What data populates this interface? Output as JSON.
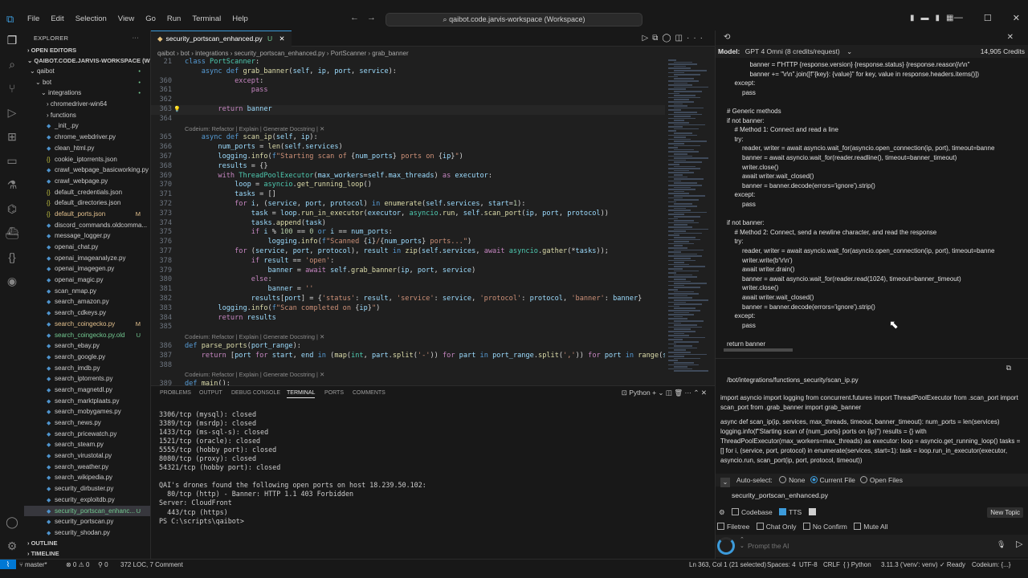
{
  "titlebar": {
    "menu": [
      "File",
      "Edit",
      "Selection",
      "View",
      "Go",
      "Run",
      "Terminal",
      "Help"
    ],
    "search_text": "qaibot.code.jarvis-workspace (Workspace)"
  },
  "sidebar": {
    "title": "EXPLORER",
    "open_editors": "OPEN EDITORS",
    "workspace": "QAIBOT.CODE.JARVIS-WORKSPACE (WOR...",
    "tree": [
      {
        "label": "qaibot",
        "kind": "folder-open",
        "indent": 1,
        "badge": "•"
      },
      {
        "label": "bot",
        "kind": "folder-open",
        "indent": 2,
        "badge": "•"
      },
      {
        "label": "integrations",
        "kind": "folder-open",
        "indent": 3,
        "badge": "•"
      },
      {
        "label": "chromedriver-win64",
        "kind": "folder",
        "indent": 4,
        "badge": ""
      },
      {
        "label": "functions",
        "kind": "folder",
        "indent": 4,
        "badge": ""
      },
      {
        "label": "_init_.py",
        "kind": "py",
        "indent": 4,
        "badge": ""
      },
      {
        "label": "chrome_webdriver.py",
        "kind": "py",
        "indent": 4,
        "badge": ""
      },
      {
        "label": "clean_html.py",
        "kind": "py",
        "indent": 4,
        "badge": ""
      },
      {
        "label": "cookie_iptorrents.json",
        "kind": "json",
        "indent": 4,
        "badge": ""
      },
      {
        "label": "crawl_webpage_basicworking.py",
        "kind": "py",
        "indent": 4,
        "badge": ""
      },
      {
        "label": "crawl_webpage.py",
        "kind": "py",
        "indent": 4,
        "badge": ""
      },
      {
        "label": "default_credentials.json",
        "kind": "json",
        "indent": 4,
        "badge": ""
      },
      {
        "label": "default_directories.json",
        "kind": "json",
        "indent": 4,
        "badge": ""
      },
      {
        "label": "default_ports.json",
        "kind": "json",
        "indent": 4,
        "badge": "M"
      },
      {
        "label": "discord_commands.oldcomma...",
        "kind": "py",
        "indent": 4,
        "badge": ""
      },
      {
        "label": "message_logger.py",
        "kind": "py",
        "indent": 4,
        "badge": ""
      },
      {
        "label": "openai_chat.py",
        "kind": "py",
        "indent": 4,
        "badge": ""
      },
      {
        "label": "openai_imageanalyze.py",
        "kind": "py",
        "indent": 4,
        "badge": ""
      },
      {
        "label": "openai_imagegen.py",
        "kind": "py",
        "indent": 4,
        "badge": ""
      },
      {
        "label": "openai_magic.py",
        "kind": "py",
        "indent": 4,
        "badge": ""
      },
      {
        "label": "scan_nmap.py",
        "kind": "py",
        "indent": 4,
        "badge": ""
      },
      {
        "label": "search_amazon.py",
        "kind": "py",
        "indent": 4,
        "badge": ""
      },
      {
        "label": "search_cdkeys.py",
        "kind": "py",
        "indent": 4,
        "badge": ""
      },
      {
        "label": "search_coingecko.py",
        "kind": "py",
        "indent": 4,
        "badge": "M"
      },
      {
        "label": "search_coingecko.py.old",
        "kind": "py",
        "indent": 4,
        "badge": "U"
      },
      {
        "label": "search_ebay.py",
        "kind": "py",
        "indent": 4,
        "badge": ""
      },
      {
        "label": "search_google.py",
        "kind": "py",
        "indent": 4,
        "badge": ""
      },
      {
        "label": "search_imdb.py",
        "kind": "py",
        "indent": 4,
        "badge": ""
      },
      {
        "label": "search_iptorrents.py",
        "kind": "py",
        "indent": 4,
        "badge": ""
      },
      {
        "label": "search_magnetdl.py",
        "kind": "py",
        "indent": 4,
        "badge": ""
      },
      {
        "label": "search_marktplaats.py",
        "kind": "py",
        "indent": 4,
        "badge": ""
      },
      {
        "label": "search_mobygames.py",
        "kind": "py",
        "indent": 4,
        "badge": ""
      },
      {
        "label": "search_news.py",
        "kind": "py",
        "indent": 4,
        "badge": ""
      },
      {
        "label": "search_pricewatch.py",
        "kind": "py",
        "indent": 4,
        "badge": ""
      },
      {
        "label": "search_steam.py",
        "kind": "py",
        "indent": 4,
        "badge": ""
      },
      {
        "label": "search_virustotal.py",
        "kind": "py",
        "indent": 4,
        "badge": ""
      },
      {
        "label": "search_weather.py",
        "kind": "py",
        "indent": 4,
        "badge": ""
      },
      {
        "label": "search_wikipedia.py",
        "kind": "py",
        "indent": 4,
        "badge": ""
      },
      {
        "label": "security_dirbuster.py",
        "kind": "py",
        "indent": 4,
        "badge": ""
      },
      {
        "label": "security_exploitdb.py",
        "kind": "py",
        "indent": 4,
        "badge": ""
      },
      {
        "label": "security_portscan_enhanc...",
        "kind": "py",
        "indent": 4,
        "badge": "U",
        "selected": true
      },
      {
        "label": "security_portscan.py",
        "kind": "py",
        "indent": 4,
        "badge": ""
      },
      {
        "label": "security_shodan.py",
        "kind": "py",
        "indent": 4,
        "badge": ""
      }
    ],
    "outline": "OUTLINE",
    "timeline": "TIMELINE"
  },
  "editor": {
    "tab_label": "security_portscan_enhanced.py",
    "tab_badge": "U",
    "breadcrumb": [
      "qaibot",
      "bot",
      "integrations",
      "security_portscan_enhanced.py",
      "PortScanner",
      "grab_banner"
    ],
    "lens_text": "Codeium: Refactor | Explain | Generate Docstring | ✕"
  },
  "panel": {
    "tabs": [
      "PROBLEMS",
      "OUTPUT",
      "DEBUG CONSOLE",
      "TERMINAL",
      "PORTS",
      "COMMENTS"
    ],
    "active_tab": "TERMINAL",
    "shell": "Python",
    "terminal_lines": [
      "3306/tcp (mysql): closed",
      "3389/tcp (msrdp): closed",
      "1433/tcp (ms-sql-s): closed",
      "1521/tcp (oracle): closed",
      "5555/tcp (hobby port): closed",
      "8080/tcp (proxy): closed",
      "54321/tcp (hobby port): closed",
      "",
      "QAI's drones found the following open ports on host 18.239.50.102:",
      "  80/tcp (http) - Banner: HTTP 1.1 403 Forbidden",
      "Server: CloudFront",
      "  443/tcp (https)",
      "PS C:\\scripts\\qaibot> "
    ]
  },
  "chat": {
    "model_label": "Model:",
    "model_value": "GPT 4 Omni (8 credits/request)",
    "credits": "14,905 Credits",
    "response_lines": [
      {
        "t": "banner = f\"HTTP {response.version} {response.status} {response.reason}\\r\\n\"",
        "i": 3
      },
      {
        "t": "banner += \"\\r\\n\".join([f\"{key}: {value}\" for key, value in response.headers.items()])",
        "i": 3
      },
      {
        "t": "except:",
        "i": 1
      },
      {
        "t": "pass",
        "i": 2
      },
      {
        "t": "",
        "i": 0
      },
      {
        "t": "# Generic methods",
        "i": 0
      },
      {
        "t": "if not banner:",
        "i": 0
      },
      {
        "t": "# Method 1: Connect and read a line",
        "i": 1
      },
      {
        "t": "try:",
        "i": 1
      },
      {
        "t": "reader, writer = await asyncio.wait_for(asyncio.open_connection(ip, port), timeout=banne",
        "i": 2
      },
      {
        "t": "banner = await asyncio.wait_for(reader.readline(), timeout=banner_timeout)",
        "i": 2
      },
      {
        "t": "writer.close()",
        "i": 2
      },
      {
        "t": "await writer.wait_closed()",
        "i": 2
      },
      {
        "t": "banner = banner.decode(errors='ignore').strip()",
        "i": 2
      },
      {
        "t": "except:",
        "i": 1
      },
      {
        "t": "pass",
        "i": 2
      },
      {
        "t": "",
        "i": 0
      },
      {
        "t": "if not banner:",
        "i": 0
      },
      {
        "t": "# Method 2: Connect, send a newline character, and read the response",
        "i": 1
      },
      {
        "t": "try:",
        "i": 1
      },
      {
        "t": "reader, writer = await asyncio.wait_for(asyncio.open_connection(ip, port), timeout=banne",
        "i": 2
      },
      {
        "t": "writer.write(b'\\r\\n')",
        "i": 2
      },
      {
        "t": "await writer.drain()",
        "i": 2
      },
      {
        "t": "banner = await asyncio.wait_for(reader.read(1024), timeout=banner_timeout)",
        "i": 2
      },
      {
        "t": "writer.close()",
        "i": 2
      },
      {
        "t": "await writer.wait_closed()",
        "i": 2
      },
      {
        "t": "banner = banner.decode(errors='ignore').strip()",
        "i": 2
      },
      {
        "t": "except:",
        "i": 1
      },
      {
        "t": "pass",
        "i": 2
      },
      {
        "t": "",
        "i": 0
      },
      {
        "t": "return banner",
        "i": 0
      }
    ],
    "file_path": "/bot/integrations/functions_security/scan_ip.py",
    "summary_1": "import asyncio import logging from concurrent.futures import ThreadPoolExecutor from .scan_port import scan_port from .grab_banner import grab_banner",
    "summary_2": "async def scan_ip(ip, services, max_threads, timeout, banner_timeout): num_ports = len(services) logging.info(f\"Starting scan of {num_ports} ports on {ip}\") results = {} with ThreadPoolExecutor(max_workers=max_threads) as executor: loop = asyncio.get_running_loop() tasks = [] for i, (service, port, protocol) in enumerate(services, start=1): task = loop.run_in_executor(executor, asyncio.run, scan_port(ip, port, protocol, timeout))",
    "autoselect_label": "Auto-select:",
    "autoselect_options": [
      "None",
      "Current File",
      "Open Files"
    ],
    "autoselect_value": "Current File",
    "current_file": "security_portscan_enhanced.py",
    "opt_codebase": "Codebase",
    "opt_tts": "TTS",
    "new_topic": "New Topic",
    "opt_filetree": "Filetree",
    "opt_chat_only": "Chat Only",
    "opt_no_confirm": "No Confirm",
    "opt_mute_all": "Mute All",
    "prompt_placeholder": "Prompt the AI"
  },
  "status": {
    "branch": "master*",
    "errors": "⊗ 0 ⚠ 0",
    "ports": "⚲ 0",
    "loc": "372 LOC, 7 Comment",
    "position": "Ln 363, Col 1 (21 selected)",
    "spaces": "Spaces: 4",
    "encoding": "UTF-8",
    "eol": "CRLF",
    "language": "{ } Python",
    "interpreter": "3.11.3 ('venv': venv)",
    "ready": "✓ Ready",
    "codeium": "Codeium: {...}"
  }
}
